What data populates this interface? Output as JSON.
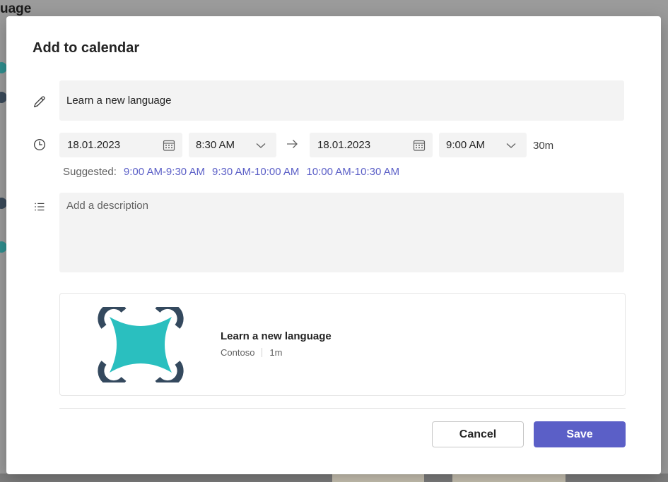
{
  "background": {
    "page_title": "uage"
  },
  "dialog": {
    "title": "Add to calendar",
    "event_title": "Learn a new language",
    "start_date": "18.01.2023",
    "start_time": "8:30 AM",
    "end_date": "18.01.2023",
    "end_time": "9:00 AM",
    "duration": "30m",
    "suggested_label": "Suggested:",
    "suggestions": [
      "9:00 AM-9:30 AM",
      "9:30 AM-10:00 AM",
      "10:00 AM-10:30 AM"
    ],
    "description_placeholder": "Add a description",
    "card": {
      "title": "Learn a new language",
      "provider": "Contoso",
      "duration": "1m"
    },
    "cancel_label": "Cancel",
    "save_label": "Save"
  },
  "icons": {
    "title": "pencil-icon",
    "time": "clock-icon",
    "description": "list-icon",
    "date_picker": "calendar-icon",
    "time_picker": "chevron-down-icon",
    "range": "arrow-right-icon"
  },
  "colors": {
    "accent": "#5b5fc7",
    "logo_teal": "#2abfbf",
    "logo_dark": "#34495e"
  }
}
